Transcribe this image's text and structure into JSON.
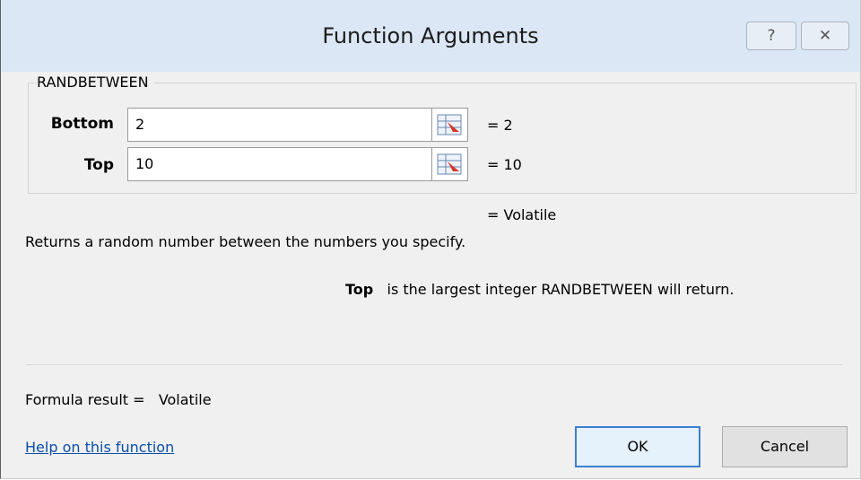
{
  "window": {
    "title": "Function Arguments",
    "help_glyph": "?",
    "close_glyph": "✕"
  },
  "function_group": {
    "name": "RANDBETWEEN",
    "args": [
      {
        "label": "Bottom",
        "value": "2",
        "eval": "=  2",
        "icon": "range-select-icon"
      },
      {
        "label": "Top",
        "value": "10",
        "eval": "=  10",
        "icon": "range-select-icon"
      }
    ]
  },
  "function_result": "=  Volatile",
  "description": "Returns a random number between the numbers you specify.",
  "arg_help": {
    "name": "Top",
    "text": "is the largest integer RANDBETWEEN will return."
  },
  "formula_result": {
    "label": "Formula result =",
    "value": "Volatile"
  },
  "help_link": "Help on this function",
  "buttons": {
    "ok": "OK",
    "cancel": "Cancel"
  }
}
